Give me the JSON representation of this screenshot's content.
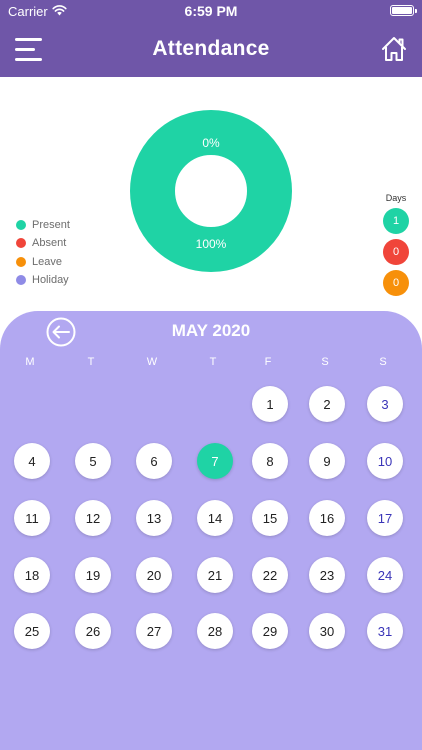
{
  "status_bar": {
    "carrier": "Carrier",
    "time": "6:59 PM"
  },
  "nav": {
    "title": "Attendance"
  },
  "chart_data": {
    "type": "pie",
    "categories": [
      "Present",
      "Absent",
      "Leave",
      "Holiday"
    ],
    "values": [
      100,
      0,
      0,
      0
    ],
    "slice_labels": [
      "100%",
      "0%"
    ],
    "colors": [
      "#1fd3a5",
      "#f0453a",
      "#f7900a",
      "#8f8be6"
    ]
  },
  "legend": [
    {
      "label": "Present",
      "color": "#1fd3a5"
    },
    {
      "label": "Absent",
      "color": "#f0453a"
    },
    {
      "label": "Leave",
      "color": "#f7900a"
    },
    {
      "label": "Holiday",
      "color": "#8f8be6"
    }
  ],
  "days_panel": {
    "title": "Days",
    "counts": [
      {
        "value": "1",
        "color": "#1fd3a5"
      },
      {
        "value": "0",
        "color": "#f0453a"
      },
      {
        "value": "0",
        "color": "#f7900a"
      }
    ]
  },
  "calendar": {
    "month": "MAY 2020",
    "weekdays": [
      "M",
      "T",
      "W",
      "T",
      "F",
      "S",
      "S"
    ],
    "first_weekday": 4,
    "days_in_month": 31,
    "today": 7,
    "colors": {
      "background": "#b2a8f1",
      "today": "#1fd3a5",
      "weekend_text": "#3a35b8"
    }
  },
  "colors": {
    "header": "#6f56a8"
  }
}
